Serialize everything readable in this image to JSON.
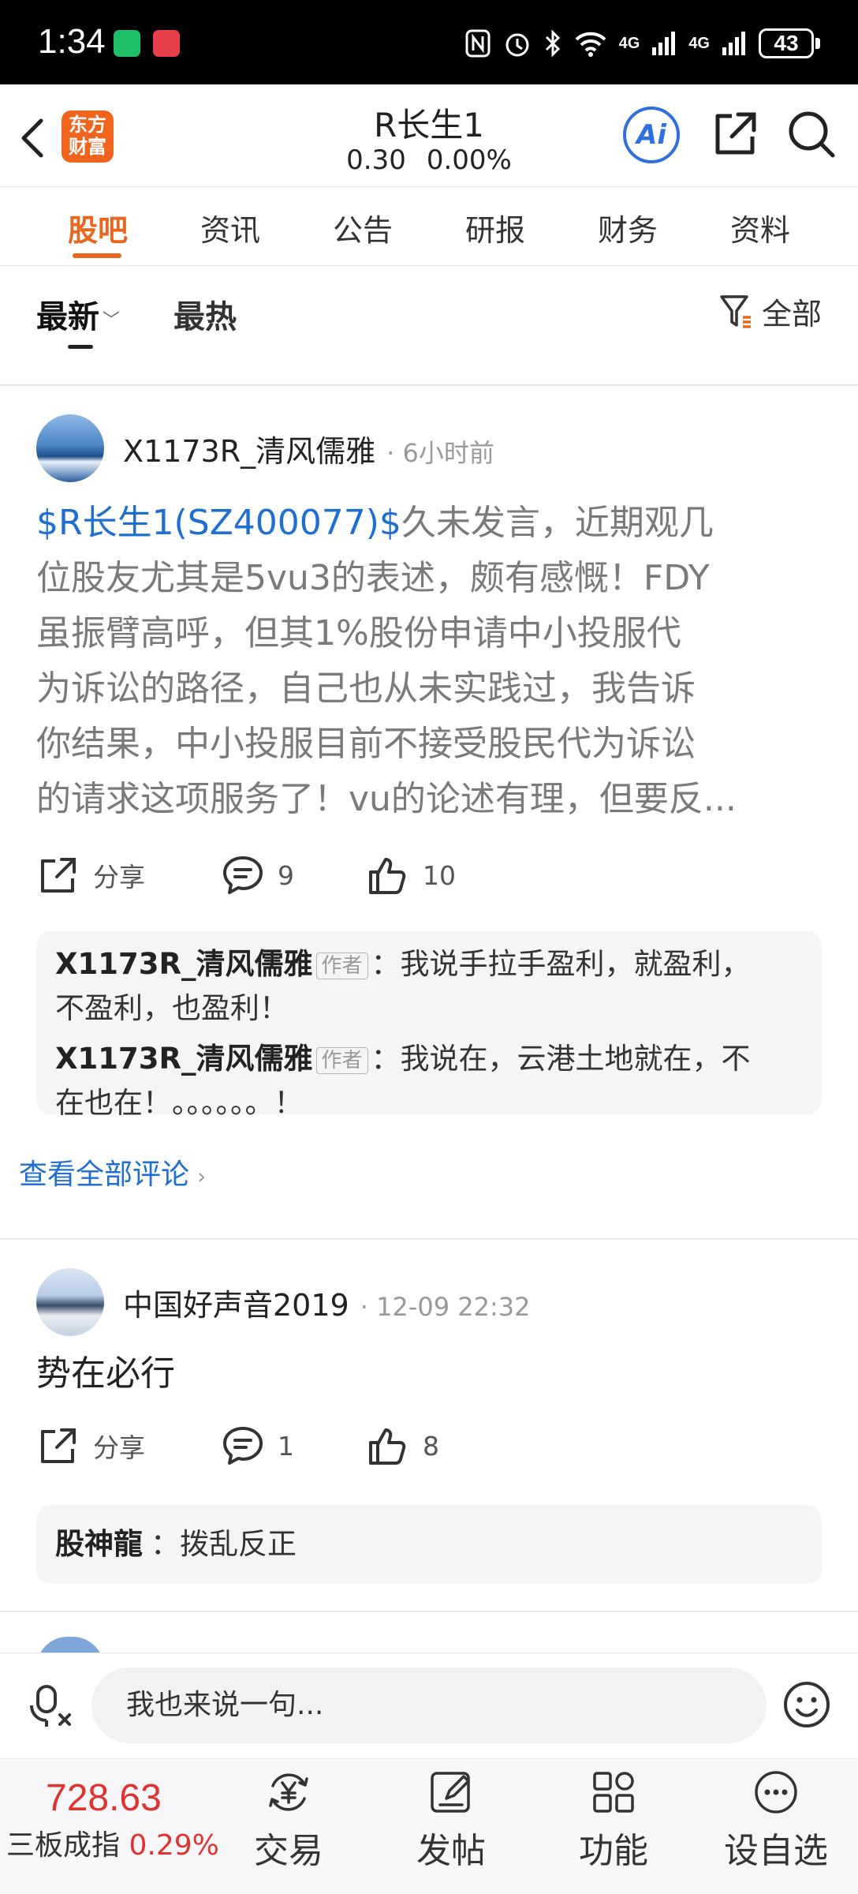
{
  "status_bar": {
    "time": "1:34",
    "battery": "43",
    "network": "4G"
  },
  "header": {
    "logo_line1": "东方",
    "logo_line2": "财富",
    "stock_name": "R长生1",
    "price": "0.30",
    "change": "0.00%",
    "ai_label": "Ai"
  },
  "tabs": [
    "股吧",
    "资讯",
    "公告",
    "研报",
    "财务",
    "资料"
  ],
  "sort": {
    "latest": "最新",
    "hot": "最热",
    "filter": "全部"
  },
  "posts": [
    {
      "author": "X1173R_清风儒雅",
      "time": "6小时前",
      "tag": "$R长生1(SZ400077)$",
      "text_lines": [
        "久未发言，近期观几",
        "位股友尤其是5vu3的表述，颇有感慨！FDY",
        "虽振臂高呼，但其1%股份申请中小投服代",
        "为诉讼的路径，自己也从未实践过，我告诉",
        "你结果，中小投服目前不接受股民代为诉讼",
        "的请求这项服务了！vu的论述有理，但要反..."
      ],
      "share_label": "分享",
      "comment_count": "9",
      "like_count": "10",
      "comments": [
        {
          "user": "X1173R_清风儒雅",
          "badge": "作者",
          "line1": "：我说手拉手盈利，就盈利，",
          "line2": "不盈利，也盈利！"
        },
        {
          "user": "X1173R_清风儒雅",
          "badge": "作者",
          "line1": "：我说在，云港土地就在，不",
          "line2": "在也在！。。。。。。！"
        }
      ],
      "view_all": "查看全部评论"
    },
    {
      "author": "中国好声音2019",
      "time": "12-09 22:32",
      "text": "势在必行",
      "share_label": "分享",
      "comment_count": "1",
      "like_count": "8",
      "comments": [
        {
          "user": "股神龍",
          "text": "：拨乱反正"
        }
      ]
    }
  ],
  "input": {
    "placeholder": "我也来说一句..."
  },
  "bottom_nav": {
    "index_value": "728.63",
    "index_name": "三板成指",
    "index_change": "0.29%",
    "items": [
      "交易",
      "发帖",
      "功能",
      "设自选"
    ]
  },
  "colors": {
    "accent": "#e8661d",
    "link": "#1f6fd2",
    "up": "#e0322f"
  }
}
